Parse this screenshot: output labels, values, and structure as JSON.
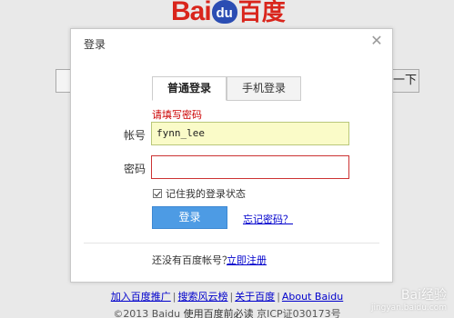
{
  "background": {
    "logo": {
      "part1": "Bai",
      "part2": "du",
      "part3": "百度"
    },
    "search_button_label": "一下",
    "footer_links": [
      "加入百度推广",
      "搜索风云榜",
      "关于百度",
      "About Baidu"
    ],
    "copyright": "©2013 Baidu",
    "copyright_link": "使用百度前必读",
    "icp": "京ICP证030173号",
    "watermark": "Bai经验",
    "watermark_url": "jingyan.baidu.com"
  },
  "dialog": {
    "title": "登录",
    "close_icon": "close-icon",
    "tabs": [
      {
        "label": "普通登录",
        "active": true
      },
      {
        "label": "手机登录",
        "active": false
      }
    ],
    "error": "请填写密码",
    "username_label": "帐号",
    "username_value": "fynn_lee",
    "password_label": "密码",
    "password_value": "",
    "remember_label": "记住我的登录状态",
    "remember_checked": true,
    "login_button": "登录",
    "forgot_link": "忘记密码？",
    "no_account_text": "还没有百度帐号？",
    "register_link": "立即注册"
  },
  "colors": {
    "brand_red": "#d9251c",
    "brand_blue": "#2b4db3",
    "button_blue": "#4d9be4",
    "error_red": "#cc0000",
    "link_blue": "#0000cc"
  }
}
